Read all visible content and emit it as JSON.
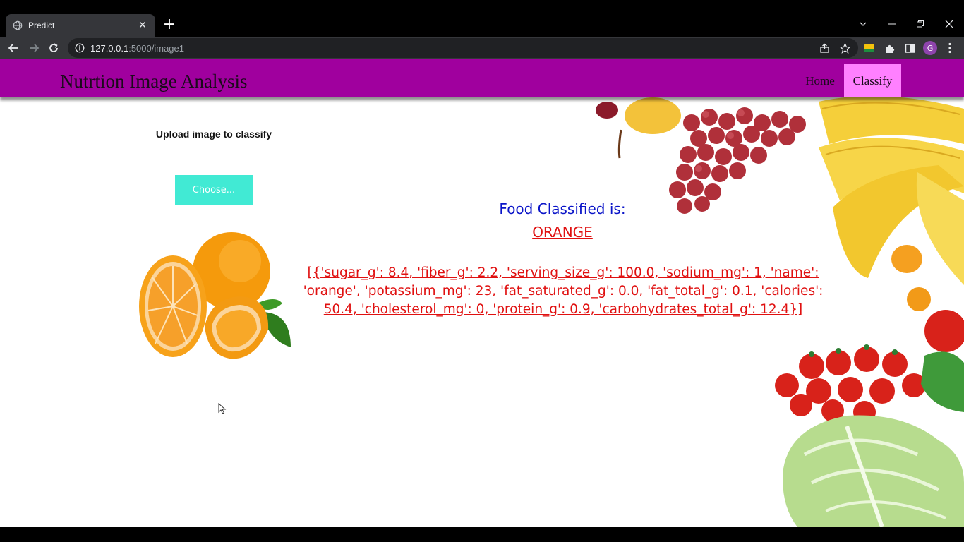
{
  "browser": {
    "tab_title": "Predict",
    "url_host": "127.0.0.1",
    "url_path": ":5000/image1",
    "profile_initial": "G"
  },
  "navbar": {
    "brand": "Nutrtion Image Analysis",
    "links": [
      {
        "label": "Home",
        "active": false
      },
      {
        "label": "Classify",
        "active": true
      }
    ],
    "bg_color": "#a0009e",
    "active_color": "#ff80ff"
  },
  "upload": {
    "title": "Upload image to classify",
    "button_label": "Choose...",
    "button_color": "#41ead4"
  },
  "result": {
    "heading": "Food Classified is:",
    "class_name": "ORANGE",
    "nutrition_text": "[{'sugar_g': 8.4, 'fiber_g': 2.2, 'serving_size_g': 100.0, 'sodium_mg': 1, 'name': 'orange', 'potassium_mg': 23, 'fat_saturated_g': 0.0, 'fat_total_g': 0.1, 'calories': 50.4, 'cholesterol_mg': 0, 'protein_g': 0.9, 'carbohydrates_total_g': 12.4}]",
    "heading_color": "#0a14c8",
    "text_color": "#e01010"
  }
}
